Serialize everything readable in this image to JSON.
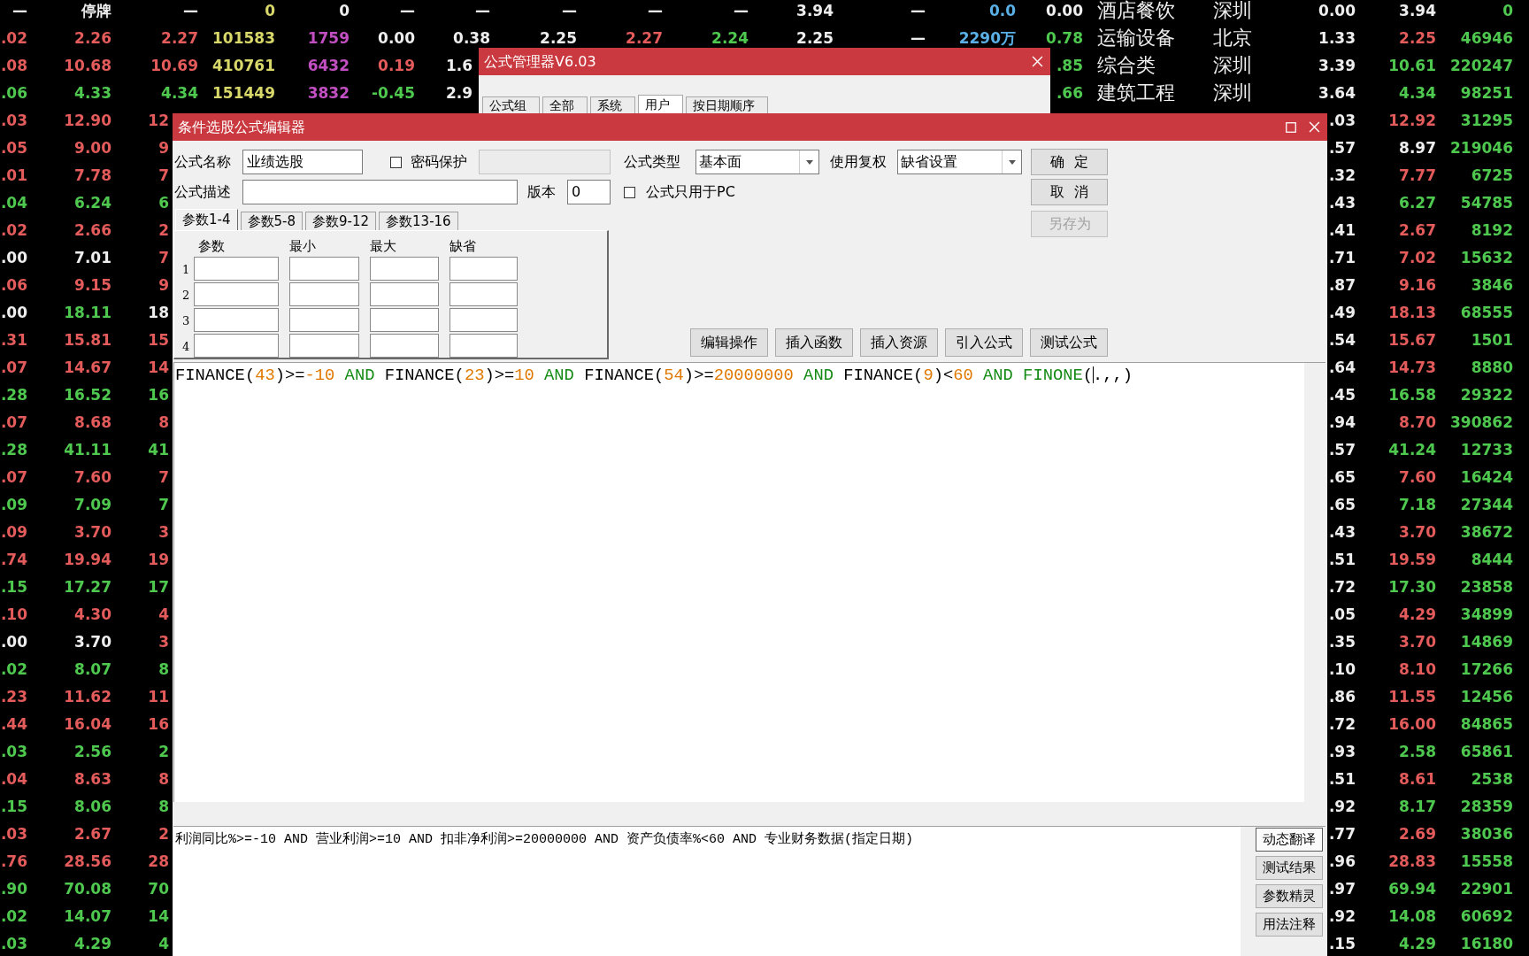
{
  "quote_table": {
    "rows": [
      {
        "left": [
          {
            "text": "—",
            "color": "#eeeeee"
          },
          {
            "text": "停牌",
            "color": "#eeeeee"
          },
          {
            "text": "—",
            "color": "#eeeeee"
          },
          {
            "text": "0",
            "color": "#d8d86a"
          },
          {
            "text": "0",
            "color": "#eeeeee"
          },
          {
            "text": "—",
            "color": "#eeeeee"
          },
          {
            "text": "—",
            "color": "#eeeeee"
          },
          {
            "text": "—",
            "color": "#eeeeee"
          },
          {
            "text": "—",
            "color": "#eeeeee"
          },
          {
            "text": "—",
            "color": "#eeeeee"
          },
          {
            "text": "3.94",
            "color": "#eeeeee"
          },
          {
            "text": "—",
            "color": "#eeeeee"
          },
          {
            "text": "0.0",
            "color": "#5ab0e6"
          },
          {
            "text": "0.00",
            "color": "#eeeeee"
          },
          {
            "text": "酒店餐饮",
            "color": "#eeeeee"
          },
          {
            "text": "深圳",
            "color": "#eeeeee"
          },
          {
            "text": "0.00",
            "color": "#eeeeee"
          },
          {
            "text": "3.94",
            "color": "#eeeeee"
          },
          {
            "text": "0",
            "color": "#4fc84f"
          }
        ]
      },
      {
        "left": [
          {
            "text": ".02",
            "color": "#e35b5b"
          },
          {
            "text": "2.26",
            "color": "#e35b5b"
          },
          {
            "text": "2.27",
            "color": "#e35b5b"
          },
          {
            "text": "101583",
            "color": "#d8d86a"
          },
          {
            "text": "1759",
            "color": "#c24fc2"
          },
          {
            "text": "0.00",
            "color": "#eeeeee"
          },
          {
            "text": "0.38",
            "color": "#eeeeee"
          },
          {
            "text": "2.25",
            "color": "#eeeeee"
          },
          {
            "text": "2.27",
            "color": "#e35b5b"
          },
          {
            "text": "2.24",
            "color": "#4fc84f"
          },
          {
            "text": "2.25",
            "color": "#eeeeee"
          },
          {
            "text": "—",
            "color": "#eeeeee"
          },
          {
            "text": "2290万",
            "color": "#5ab0e6"
          },
          {
            "text": "0.78",
            "color": "#4fc84f"
          },
          {
            "text": "运输设备",
            "color": "#eeeeee"
          },
          {
            "text": "北京",
            "color": "#eeeeee"
          },
          {
            "text": "1.33",
            "color": "#eeeeee"
          },
          {
            "text": "2.25",
            "color": "#e35b5b"
          },
          {
            "text": "46946",
            "color": "#4fc84f"
          }
        ]
      },
      {
        "left": [
          {
            "text": ".08",
            "color": "#e35b5b"
          },
          {
            "text": "10.68",
            "color": "#e35b5b"
          },
          {
            "text": "10.69",
            "color": "#e35b5b"
          },
          {
            "text": "410761",
            "color": "#d8d86a"
          },
          {
            "text": "6432",
            "color": "#c24fc2"
          },
          {
            "text": "0.19",
            "color": "#e35b5b"
          },
          {
            "text": "1.6",
            "color": "#eeeeee"
          }
        ],
        "right": [
          {
            "text": ".85",
            "color": "#4fc84f"
          },
          {
            "text": "综合类",
            "color": "#eeeeee"
          },
          {
            "text": "深圳",
            "color": "#eeeeee"
          },
          {
            "text": "3.39",
            "color": "#eeeeee"
          },
          {
            "text": "10.61",
            "color": "#4fc84f"
          },
          {
            "text": "220247",
            "color": "#4fc84f"
          }
        ]
      },
      {
        "left": [
          {
            "text": ".06",
            "color": "#4fc84f"
          },
          {
            "text": "4.33",
            "color": "#4fc84f"
          },
          {
            "text": "4.34",
            "color": "#4fc84f"
          },
          {
            "text": "151449",
            "color": "#d8d86a"
          },
          {
            "text": "3832",
            "color": "#c24fc2"
          },
          {
            "text": "-0.45",
            "color": "#4fc84f"
          },
          {
            "text": "2.9",
            "color": "#eeeeee"
          }
        ],
        "right": [
          {
            "text": ".66",
            "color": "#4fc84f"
          },
          {
            "text": "建筑工程",
            "color": "#eeeeee"
          },
          {
            "text": "深圳",
            "color": "#eeeeee"
          },
          {
            "text": "3.64",
            "color": "#eeeeee"
          },
          {
            "text": "4.34",
            "color": "#4fc84f"
          },
          {
            "text": "98251",
            "color": "#4fc84f"
          }
        ]
      },
      {
        "left": [
          {
            "text": ".03",
            "color": "#e35b5b"
          },
          {
            "text": "12.90",
            "color": "#e35b5b"
          },
          {
            "text": "12",
            "color": "#e35b5b"
          }
        ],
        "right": [
          {
            "text": ".03",
            "color": "#eeeeee"
          },
          {
            "text": "12.92",
            "color": "#e35b5b"
          },
          {
            "text": "31295",
            "color": "#4fc84f"
          }
        ]
      },
      {
        "left": [
          {
            "text": ".05",
            "color": "#e35b5b"
          },
          {
            "text": "9.00",
            "color": "#e35b5b"
          },
          {
            "text": "9",
            "color": "#e35b5b"
          }
        ],
        "right": [
          {
            "text": ".57",
            "color": "#eeeeee"
          },
          {
            "text": "8.97",
            "color": "#eeeeee"
          },
          {
            "text": "219046",
            "color": "#4fc84f"
          }
        ]
      },
      {
        "left": [
          {
            "text": ".01",
            "color": "#e35b5b"
          },
          {
            "text": "7.78",
            "color": "#e35b5b"
          },
          {
            "text": "7",
            "color": "#e35b5b"
          }
        ],
        "right": [
          {
            "text": ".32",
            "color": "#eeeeee"
          },
          {
            "text": "7.77",
            "color": "#e35b5b"
          },
          {
            "text": "6725",
            "color": "#4fc84f"
          }
        ]
      },
      {
        "left": [
          {
            "text": ".04",
            "color": "#4fc84f"
          },
          {
            "text": "6.24",
            "color": "#4fc84f"
          },
          {
            "text": "6",
            "color": "#4fc84f"
          }
        ],
        "right": [
          {
            "text": ".43",
            "color": "#eeeeee"
          },
          {
            "text": "6.27",
            "color": "#4fc84f"
          },
          {
            "text": "54785",
            "color": "#4fc84f"
          }
        ]
      },
      {
        "left": [
          {
            "text": ".02",
            "color": "#e35b5b"
          },
          {
            "text": "2.66",
            "color": "#e35b5b"
          },
          {
            "text": "2",
            "color": "#e35b5b"
          }
        ],
        "right": [
          {
            "text": ".41",
            "color": "#eeeeee"
          },
          {
            "text": "2.67",
            "color": "#e35b5b"
          },
          {
            "text": "8192",
            "color": "#4fc84f"
          }
        ]
      },
      {
        "left": [
          {
            "text": ".00",
            "color": "#eeeeee"
          },
          {
            "text": "7.01",
            "color": "#eeeeee"
          },
          {
            "text": "7",
            "color": "#e35b5b"
          }
        ],
        "right": [
          {
            "text": ".71",
            "color": "#eeeeee"
          },
          {
            "text": "7.02",
            "color": "#e35b5b"
          },
          {
            "text": "15632",
            "color": "#4fc84f"
          }
        ]
      },
      {
        "left": [
          {
            "text": ".06",
            "color": "#e35b5b"
          },
          {
            "text": "9.15",
            "color": "#e35b5b"
          },
          {
            "text": "9",
            "color": "#e35b5b"
          }
        ],
        "right": [
          {
            "text": ".87",
            "color": "#eeeeee"
          },
          {
            "text": "9.16",
            "color": "#e35b5b"
          },
          {
            "text": "3846",
            "color": "#4fc84f"
          }
        ]
      },
      {
        "left": [
          {
            "text": ".00",
            "color": "#eeeeee"
          },
          {
            "text": "18.11",
            "color": "#4fc84f"
          },
          {
            "text": "18",
            "color": "#eeeeee"
          }
        ],
        "right": [
          {
            "text": ".49",
            "color": "#eeeeee"
          },
          {
            "text": "18.13",
            "color": "#e35b5b"
          },
          {
            "text": "68555",
            "color": "#4fc84f"
          }
        ]
      },
      {
        "left": [
          {
            "text": ".31",
            "color": "#e35b5b"
          },
          {
            "text": "15.81",
            "color": "#e35b5b"
          },
          {
            "text": "15",
            "color": "#e35b5b"
          }
        ],
        "right": [
          {
            "text": ".54",
            "color": "#eeeeee"
          },
          {
            "text": "15.67",
            "color": "#e35b5b"
          },
          {
            "text": "1501",
            "color": "#4fc84f"
          }
        ]
      },
      {
        "left": [
          {
            "text": ".07",
            "color": "#e35b5b"
          },
          {
            "text": "14.67",
            "color": "#e35b5b"
          },
          {
            "text": "14",
            "color": "#e35b5b"
          }
        ],
        "right": [
          {
            "text": ".64",
            "color": "#eeeeee"
          },
          {
            "text": "14.73",
            "color": "#e35b5b"
          },
          {
            "text": "8880",
            "color": "#4fc84f"
          }
        ]
      },
      {
        "left": [
          {
            "text": ".28",
            "color": "#4fc84f"
          },
          {
            "text": "16.52",
            "color": "#4fc84f"
          },
          {
            "text": "16",
            "color": "#4fc84f"
          }
        ],
        "right": [
          {
            "text": ".45",
            "color": "#eeeeee"
          },
          {
            "text": "16.58",
            "color": "#4fc84f"
          },
          {
            "text": "29322",
            "color": "#4fc84f"
          }
        ]
      },
      {
        "left": [
          {
            "text": ".07",
            "color": "#e35b5b"
          },
          {
            "text": "8.68",
            "color": "#e35b5b"
          },
          {
            "text": "8",
            "color": "#e35b5b"
          }
        ],
        "right": [
          {
            "text": ".94",
            "color": "#eeeeee"
          },
          {
            "text": "8.70",
            "color": "#e35b5b"
          },
          {
            "text": "390862",
            "color": "#4fc84f"
          }
        ]
      },
      {
        "left": [
          {
            "text": ".28",
            "color": "#4fc84f"
          },
          {
            "text": "41.11",
            "color": "#4fc84f"
          },
          {
            "text": "41",
            "color": "#4fc84f"
          }
        ],
        "right": [
          {
            "text": ".57",
            "color": "#eeeeee"
          },
          {
            "text": "41.24",
            "color": "#4fc84f"
          },
          {
            "text": "12733",
            "color": "#4fc84f"
          }
        ]
      },
      {
        "left": [
          {
            "text": ".07",
            "color": "#e35b5b"
          },
          {
            "text": "7.60",
            "color": "#e35b5b"
          },
          {
            "text": "7",
            "color": "#e35b5b"
          }
        ],
        "right": [
          {
            "text": ".65",
            "color": "#eeeeee"
          },
          {
            "text": "7.60",
            "color": "#e35b5b"
          },
          {
            "text": "16424",
            "color": "#4fc84f"
          }
        ]
      },
      {
        "left": [
          {
            "text": ".09",
            "color": "#4fc84f"
          },
          {
            "text": "7.09",
            "color": "#4fc84f"
          },
          {
            "text": "7",
            "color": "#4fc84f"
          }
        ],
        "right": [
          {
            "text": ".65",
            "color": "#eeeeee"
          },
          {
            "text": "7.18",
            "color": "#4fc84f"
          },
          {
            "text": "27344",
            "color": "#4fc84f"
          }
        ]
      },
      {
        "left": [
          {
            "text": ".09",
            "color": "#e35b5b"
          },
          {
            "text": "3.70",
            "color": "#e35b5b"
          },
          {
            "text": "3",
            "color": "#e35b5b"
          }
        ],
        "right": [
          {
            "text": ".43",
            "color": "#eeeeee"
          },
          {
            "text": "3.70",
            "color": "#e35b5b"
          },
          {
            "text": "38672",
            "color": "#4fc84f"
          }
        ]
      },
      {
        "left": [
          {
            "text": ".74",
            "color": "#e35b5b"
          },
          {
            "text": "19.94",
            "color": "#e35b5b"
          },
          {
            "text": "19",
            "color": "#e35b5b"
          }
        ],
        "right": [
          {
            "text": ".51",
            "color": "#eeeeee"
          },
          {
            "text": "19.59",
            "color": "#e35b5b"
          },
          {
            "text": "8444",
            "color": "#4fc84f"
          }
        ]
      },
      {
        "left": [
          {
            "text": ".15",
            "color": "#4fc84f"
          },
          {
            "text": "17.27",
            "color": "#4fc84f"
          },
          {
            "text": "17",
            "color": "#4fc84f"
          }
        ],
        "right": [
          {
            "text": ".72",
            "color": "#eeeeee"
          },
          {
            "text": "17.30",
            "color": "#4fc84f"
          },
          {
            "text": "23858",
            "color": "#4fc84f"
          }
        ]
      },
      {
        "left": [
          {
            "text": ".10",
            "color": "#e35b5b"
          },
          {
            "text": "4.30",
            "color": "#e35b5b"
          },
          {
            "text": "4",
            "color": "#e35b5b"
          }
        ],
        "right": [
          {
            "text": ".05",
            "color": "#eeeeee"
          },
          {
            "text": "4.29",
            "color": "#e35b5b"
          },
          {
            "text": "34899",
            "color": "#4fc84f"
          }
        ]
      },
      {
        "left": [
          {
            "text": ".00",
            "color": "#eeeeee"
          },
          {
            "text": "3.70",
            "color": "#eeeeee"
          },
          {
            "text": "3",
            "color": "#e35b5b"
          }
        ],
        "right": [
          {
            "text": ".35",
            "color": "#eeeeee"
          },
          {
            "text": "3.70",
            "color": "#e35b5b"
          },
          {
            "text": "14869",
            "color": "#4fc84f"
          }
        ]
      },
      {
        "left": [
          {
            "text": ".02",
            "color": "#4fc84f"
          },
          {
            "text": "8.07",
            "color": "#4fc84f"
          },
          {
            "text": "8",
            "color": "#4fc84f"
          }
        ],
        "right": [
          {
            "text": ".10",
            "color": "#eeeeee"
          },
          {
            "text": "8.10",
            "color": "#e35b5b"
          },
          {
            "text": "17266",
            "color": "#4fc84f"
          }
        ]
      },
      {
        "left": [
          {
            "text": ".23",
            "color": "#e35b5b"
          },
          {
            "text": "11.62",
            "color": "#e35b5b"
          },
          {
            "text": "11",
            "color": "#e35b5b"
          }
        ],
        "right": [
          {
            "text": ".86",
            "color": "#eeeeee"
          },
          {
            "text": "11.55",
            "color": "#e35b5b"
          },
          {
            "text": "12456",
            "color": "#4fc84f"
          }
        ]
      },
      {
        "left": [
          {
            "text": ".44",
            "color": "#e35b5b"
          },
          {
            "text": "16.04",
            "color": "#e35b5b"
          },
          {
            "text": "16",
            "color": "#e35b5b"
          }
        ],
        "right": [
          {
            "text": ".72",
            "color": "#eeeeee"
          },
          {
            "text": "16.00",
            "color": "#e35b5b"
          },
          {
            "text": "84865",
            "color": "#4fc84f"
          }
        ]
      },
      {
        "left": [
          {
            "text": ".03",
            "color": "#4fc84f"
          },
          {
            "text": "2.56",
            "color": "#4fc84f"
          },
          {
            "text": "2",
            "color": "#4fc84f"
          }
        ],
        "right": [
          {
            "text": ".93",
            "color": "#eeeeee"
          },
          {
            "text": "2.58",
            "color": "#4fc84f"
          },
          {
            "text": "65861",
            "color": "#4fc84f"
          }
        ]
      },
      {
        "left": [
          {
            "text": ".04",
            "color": "#e35b5b"
          },
          {
            "text": "8.63",
            "color": "#e35b5b"
          },
          {
            "text": "8",
            "color": "#e35b5b"
          }
        ],
        "right": [
          {
            "text": ".51",
            "color": "#eeeeee"
          },
          {
            "text": "8.61",
            "color": "#e35b5b"
          },
          {
            "text": "2538",
            "color": "#4fc84f"
          }
        ]
      },
      {
        "left": [
          {
            "text": ".15",
            "color": "#4fc84f"
          },
          {
            "text": "8.06",
            "color": "#4fc84f"
          },
          {
            "text": "8",
            "color": "#4fc84f"
          }
        ],
        "right": [
          {
            "text": ".92",
            "color": "#eeeeee"
          },
          {
            "text": "8.17",
            "color": "#4fc84f"
          },
          {
            "text": "28359",
            "color": "#4fc84f"
          }
        ]
      },
      {
        "left": [
          {
            "text": ".03",
            "color": "#e35b5b"
          },
          {
            "text": "2.67",
            "color": "#e35b5b"
          },
          {
            "text": "2",
            "color": "#e35b5b"
          }
        ],
        "right": [
          {
            "text": ".77",
            "color": "#eeeeee"
          },
          {
            "text": "2.69",
            "color": "#e35b5b"
          },
          {
            "text": "38036",
            "color": "#4fc84f"
          }
        ]
      },
      {
        "left": [
          {
            "text": ".76",
            "color": "#e35b5b"
          },
          {
            "text": "28.56",
            "color": "#e35b5b"
          },
          {
            "text": "28",
            "color": "#e35b5b"
          }
        ],
        "right": [
          {
            "text": ".96",
            "color": "#eeeeee"
          },
          {
            "text": "28.83",
            "color": "#e35b5b"
          },
          {
            "text": "15558",
            "color": "#4fc84f"
          }
        ]
      },
      {
        "left": [
          {
            "text": ".90",
            "color": "#4fc84f"
          },
          {
            "text": "70.08",
            "color": "#4fc84f"
          },
          {
            "text": "70",
            "color": "#4fc84f"
          }
        ],
        "right": [
          {
            "text": ".97",
            "color": "#eeeeee"
          },
          {
            "text": "69.94",
            "color": "#4fc84f"
          },
          {
            "text": "22901",
            "color": "#4fc84f"
          }
        ]
      },
      {
        "left": [
          {
            "text": ".02",
            "color": "#4fc84f"
          },
          {
            "text": "14.07",
            "color": "#4fc84f"
          },
          {
            "text": "14",
            "color": "#4fc84f"
          }
        ],
        "right": [
          {
            "text": ".92",
            "color": "#eeeeee"
          },
          {
            "text": "14.08",
            "color": "#4fc84f"
          },
          {
            "text": "60692",
            "color": "#4fc84f"
          }
        ]
      },
      {
        "left": [
          {
            "text": ".03",
            "color": "#4fc84f"
          },
          {
            "text": "4.29",
            "color": "#4fc84f"
          },
          {
            "text": "4",
            "color": "#4fc84f"
          }
        ],
        "right": [
          {
            "text": ".15",
            "color": "#eeeeee"
          },
          {
            "text": "4.29",
            "color": "#4fc84f"
          },
          {
            "text": "16180",
            "color": "#4fc84f"
          }
        ]
      }
    ]
  },
  "manager_window": {
    "title": "公式管理器V6.03",
    "tabs": [
      {
        "label": "公式组",
        "selected": false
      },
      {
        "label": "全部",
        "selected": false
      },
      {
        "label": "系统",
        "selected": false
      },
      {
        "label": "用户",
        "selected": true
      },
      {
        "label": "按日期顺序",
        "selected": false
      }
    ]
  },
  "editor_window": {
    "title": "条件选股公式编辑器",
    "name_label": "公式名称",
    "name_field": {
      "value": "业绩选股"
    },
    "password_checkbox": {
      "label": "密码保护",
      "checked": false
    },
    "password_field": {
      "disabled": true
    },
    "type_label": "公式类型",
    "type_select": {
      "value": "基本面"
    },
    "adjust_label": "使用复权",
    "adjust_select": {
      "value": "缺省设置"
    },
    "description_label": "公式描述",
    "version_label": "版本",
    "version_field": {
      "value": "0"
    },
    "pc_only_checkbox": {
      "label": "公式只用于PC",
      "checked": false
    },
    "side_buttons": [
      {
        "label": "确  定",
        "disabled": false
      },
      {
        "label": "取  消",
        "disabled": false
      },
      {
        "label": "另存为",
        "disabled": true
      }
    ],
    "param_tabs": [
      {
        "label": "参数1-4",
        "selected": true
      },
      {
        "label": "参数5-8",
        "selected": false
      },
      {
        "label": "参数9-12",
        "selected": false
      },
      {
        "label": "参数13-16",
        "selected": false
      }
    ],
    "param_table": {
      "columns": [
        "参数",
        "最小",
        "最大",
        "缺省"
      ],
      "row_labels": [
        "1",
        "2",
        "3",
        "4"
      ]
    },
    "action_buttons": [
      "编辑操作",
      "插入函数",
      "插入资源",
      "引入公式",
      "测试公式"
    ],
    "formula": [
      {
        "text": "FINANCE(",
        "kind": "plain"
      },
      {
        "text": "43",
        "kind": "number"
      },
      {
        "text": ")>=",
        "kind": "plain"
      },
      {
        "text": "-10",
        "kind": "number"
      },
      {
        "text": " AND ",
        "kind": "keyword"
      },
      {
        "text": "FINANCE(",
        "kind": "plain"
      },
      {
        "text": "23",
        "kind": "number"
      },
      {
        "text": ")>=",
        "kind": "plain"
      },
      {
        "text": "10",
        "kind": "number"
      },
      {
        "text": " AND ",
        "kind": "keyword"
      },
      {
        "text": "FINANCE(",
        "kind": "plain"
      },
      {
        "text": "54",
        "kind": "number"
      },
      {
        "text": ")>=",
        "kind": "plain"
      },
      {
        "text": "20000000",
        "kind": "number"
      },
      {
        "text": " AND ",
        "kind": "keyword"
      },
      {
        "text": "FINANCE(",
        "kind": "plain"
      },
      {
        "text": "9",
        "kind": "number"
      },
      {
        "text": ")<",
        "kind": "plain"
      },
      {
        "text": "60",
        "kind": "number"
      },
      {
        "text": " AND ",
        "kind": "keyword"
      },
      {
        "text": "FINONE",
        "kind": "keyword"
      },
      {
        "text": "(",
        "kind": "plain"
      },
      {
        "kind": "caret"
      },
      {
        "text": ".,,)",
        "kind": "plain"
      }
    ],
    "translation": "利润同比%>=-10 AND 营业利润>=10 AND 扣非净利润>=20000000 AND 资产负债率%<60 AND 专业财务数据(指定日期)",
    "panel_buttons": [
      {
        "label": "动态翻译",
        "selected": true
      },
      {
        "label": "测试结果",
        "selected": false
      },
      {
        "label": "参数精灵",
        "selected": false
      },
      {
        "label": "用法注释",
        "selected": false
      }
    ]
  }
}
